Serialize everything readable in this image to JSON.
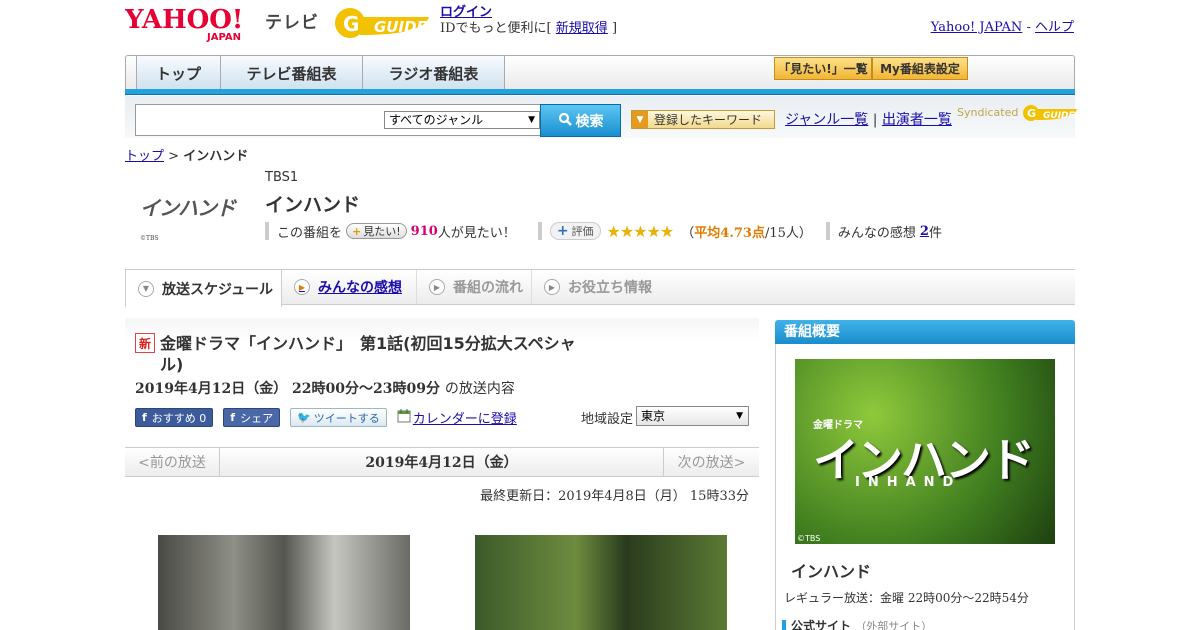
{
  "header": {
    "yahoo_logo": "YAHOO! JAPAN",
    "tv_label": "テレビ",
    "gguide_logo": "G GUIDE",
    "login_label": "ログイン",
    "login_prompt_pre": "IDでもっと便利に[",
    "signup_label": "新規取得",
    "login_prompt_post": "]",
    "yahoo_japan_link": "Yahoo! JAPAN",
    "link_sep": " - ",
    "help_link": "ヘルプ"
  },
  "nav": {
    "tabs": [
      "トップ",
      "テレビ番組表",
      "ラジオ番組表"
    ],
    "mitai_list": "「見たい!」一覧",
    "my_schedule": "My番組表設定"
  },
  "search": {
    "input_value": "",
    "genre_selected": "すべてのジャンル",
    "search_button": "検索",
    "keyword_button": "登録したキーワード",
    "genre_list_link": "ジャンル一覧",
    "divider": "|",
    "cast_list_link": "出演者一覧",
    "syndicated": "Syndicated"
  },
  "breadcrumb": {
    "top": "トップ",
    "sep": ">",
    "current": "インハンド"
  },
  "program": {
    "logo_text": "インハンド",
    "logo_copyright": "©TBS",
    "channel": "TBS1",
    "title": "インハンド",
    "mitai_pre": "この番組を",
    "mitai_button": "見たい!",
    "mitai_count": "910",
    "mitai_post": "人が見たい！",
    "rating_button": "評価",
    "stars": "★★★★★",
    "rating_open": "（",
    "rating_avg": "平均4.73点",
    "rating_count": "/15人）",
    "reviews_pre": "みんなの感想",
    "reviews_count": "2",
    "reviews_post": "件"
  },
  "tabs": [
    {
      "label": "放送スケジュール",
      "state": "active"
    },
    {
      "label": "みんなの感想",
      "state": "link"
    },
    {
      "label": "番組の流れ",
      "state": "disabled"
    },
    {
      "label": "お役立ち情報",
      "state": "disabled"
    }
  ],
  "episode": {
    "new_badge": "新",
    "title": "金曜ドラマ「インハンド」　第1話(初回15分拡大スペシャル)",
    "datetime": "2019年4月12日（金）  22時00分～23時09分",
    "datetime_suffix": "の放送内容",
    "recommend_button": "おすすめ 0",
    "share_button": "シェア",
    "tweet_button": "ツイートする",
    "calendar_link": "カレンダーに登録",
    "region_label": "地域設定",
    "region_value": "東京",
    "prev_label": "<前の放送",
    "date_label": "2019年4月12日（金）",
    "next_label": "次の放送>",
    "updated": "最終更新日：2019年4月8日（月）  15時33分"
  },
  "sidebar": {
    "heading": "番組概要",
    "image_small": "金曜ドラマ",
    "image_title": "インハンド",
    "image_sub": "INHAND",
    "image_copyright": "©TBS",
    "title": "インハンド",
    "regular": "レギュラー放送：金曜 22時00分～22時54分",
    "official_label": "公式サイト",
    "official_ext": "（外部サイト）"
  },
  "colors": {
    "accent_blue": "#22a3de",
    "mitai_orange": "#f2b634",
    "rating_orange": "#e07d00",
    "count_magenta": "#d6006f"
  }
}
